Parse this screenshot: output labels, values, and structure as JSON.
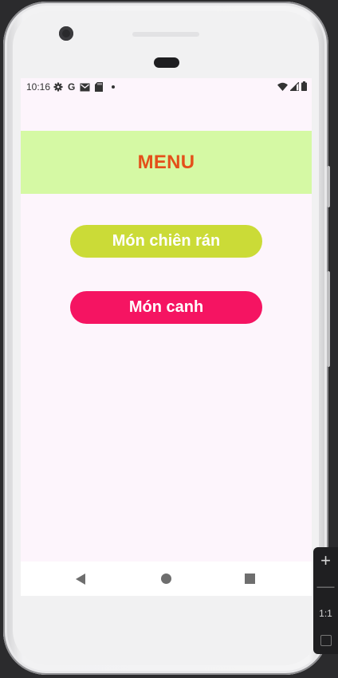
{
  "status_bar": {
    "time": "10:16",
    "icons": [
      "gear-icon",
      "google-icon",
      "gmail-icon",
      "sd-card-icon",
      "dot-icon"
    ],
    "right_icons": [
      "wifi-icon",
      "signal-icon",
      "battery-icon"
    ],
    "google_letter": "G"
  },
  "header": {
    "title": "MENU",
    "background": "#d5f9a4",
    "title_color": "#e4501a"
  },
  "buttons": [
    {
      "label": "Món chiên rán",
      "color": "#cbdb37"
    },
    {
      "label": "Món canh",
      "color": "#f51462"
    }
  ],
  "nav": {
    "items": [
      "back-icon",
      "home-icon",
      "recents-icon"
    ]
  },
  "emulator_toolbar": {
    "zoom_in": "+",
    "zoom_out": "—",
    "ratio_label": "1:1"
  }
}
